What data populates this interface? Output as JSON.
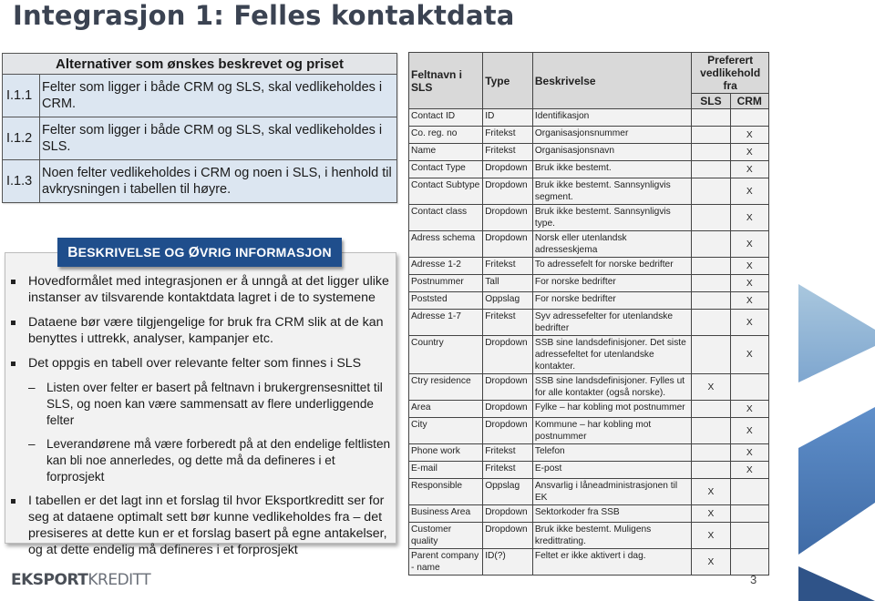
{
  "page": {
    "title": "Integrasjon 1: Felles kontaktdata",
    "page_number": "3",
    "logo": {
      "bold": "EKSPORT",
      "thin": "KREDITT"
    }
  },
  "alternatives": {
    "header": "Alternativer som ønskes beskrevet og priset",
    "rows": [
      {
        "code": "I.1.1",
        "text": "Felter som ligger i både CRM og SLS, skal vedlikeholdes i CRM."
      },
      {
        "code": "I.1.2",
        "text": "Felter som ligger i både CRM og SLS, skal vedlikeholdes i SLS."
      },
      {
        "code": "I.1.3",
        "text": "Noen felter vedlikeholdes i CRM og noen i SLS, i henhold til avkrysningen i tabellen til høyre."
      }
    ]
  },
  "info": {
    "header_caps_1": "B",
    "header_rest_1": "ESKRIVELSE OG ",
    "header_caps_2": "Ø",
    "header_rest_2": "VRIG INFORMASJON",
    "bullets": [
      "Hovedformålet med integrasjonen er å unngå at det ligger ulike instanser av tilsvarende kontaktdata lagret i de to systemene",
      "Dataene bør være tilgjengelige for bruk fra CRM slik at de kan benyttes i uttrekk, analyser, kampanjer etc.",
      "Det oppgis en tabell over relevante felter som finnes i SLS"
    ],
    "subbullets": [
      "Listen over felter er basert på feltnavn i brukergrensesnittet til SLS, og noen kan være sammensatt av flere underliggende felter",
      "Leverandørene må være forberedt på at den endelige feltlisten kan bli noe annerledes, og dette må da defineres i et forprosjekt"
    ],
    "final_bullet": "I tabellen er det lagt inn et forslag til hvor Eksportkreditt ser for seg at dataene optimalt sett bør kunne vedlikeholdes fra – det presiseres at dette kun er et forslag basert på egne antakelser, og at dette endelig må defineres i et forprosjekt"
  },
  "fields_table": {
    "headers": {
      "name": "Feltnavn i SLS",
      "type": "Type",
      "description": "Beskrivelse",
      "preferred": "Preferert vedlikehold fra",
      "sls": "SLS",
      "crm": "CRM"
    },
    "rows": [
      {
        "name": "Contact ID",
        "type": "ID",
        "desc": "Identifikasjon",
        "sls": "",
        "crm": ""
      },
      {
        "name": "Co. reg. no",
        "type": "Fritekst",
        "desc": "Organisasjonsnummer",
        "sls": "",
        "crm": "X"
      },
      {
        "name": "Name",
        "type": "Fritekst",
        "desc": "Organisasjonsnavn",
        "sls": "",
        "crm": "X"
      },
      {
        "name": "Contact Type",
        "type": "Dropdown",
        "desc": "Bruk ikke bestemt.",
        "sls": "",
        "crm": "X"
      },
      {
        "name": "Contact Subtype",
        "type": "Dropdown",
        "desc": "Bruk ikke bestemt. Sannsynligvis segment.",
        "sls": "",
        "crm": "X"
      },
      {
        "name": "Contact class",
        "type": "Dropdown",
        "desc": "Bruk ikke bestemt. Sannsynligvis type.",
        "sls": "",
        "crm": "X"
      },
      {
        "name": "Adress schema",
        "type": "Dropdown",
        "desc": "Norsk eller utenlandsk adresseskjema",
        "sls": "",
        "crm": "X"
      },
      {
        "name": "Adresse 1-2",
        "type": "Fritekst",
        "desc": "To adressefelt for norske bedrifter",
        "sls": "",
        "crm": "X"
      },
      {
        "name": "Postnummer",
        "type": "Tall",
        "desc": "For norske bedrifter",
        "sls": "",
        "crm": "X"
      },
      {
        "name": "Poststed",
        "type": "Oppslag",
        "desc": "For norske bedrifter",
        "sls": "",
        "crm": "X"
      },
      {
        "name": "Adresse 1-7",
        "type": "Fritekst",
        "desc": "Syv adressefelter for utenlandske bedrifter",
        "sls": "",
        "crm": "X"
      },
      {
        "name": "Country",
        "type": "Dropdown",
        "desc": "SSB sine landsdefinisjoner. Det siste adressefeltet for utenlandske kontakter.",
        "sls": "",
        "crm": "X"
      },
      {
        "name": "Ctry residence",
        "type": "Dropdown",
        "desc": "SSB sine landsdefinisjoner. Fylles ut for alle kontakter (også norske).",
        "sls": "X",
        "crm": ""
      },
      {
        "name": "Area",
        "type": "Dropdown",
        "desc": "Fylke – har kobling mot postnummer",
        "sls": "",
        "crm": "X"
      },
      {
        "name": "City",
        "type": "Dropdown",
        "desc": "Kommune – har kobling mot postnummer",
        "sls": "",
        "crm": "X"
      },
      {
        "name": "Phone work",
        "type": "Fritekst",
        "desc": "Telefon",
        "sls": "",
        "crm": "X"
      },
      {
        "name": "E-mail",
        "type": "Fritekst",
        "desc": "E-post",
        "sls": "",
        "crm": "X"
      },
      {
        "name": "Responsible",
        "type": "Oppslag",
        "desc": "Ansvarlig i låneadministrasjonen til EK",
        "sls": "X",
        "crm": ""
      },
      {
        "name": "Business Area",
        "type": "Dropdown",
        "desc": "Sektorkoder fra SSB",
        "sls": "X",
        "crm": ""
      },
      {
        "name": "Customer quality",
        "type": "Dropdown",
        "desc": "Bruk ikke bestemt. Muligens kredittrating.",
        "sls": "X",
        "crm": ""
      },
      {
        "name": "Parent company - name",
        "type": "ID(?)",
        "desc": "Feltet er ikke aktivert i dag.",
        "sls": "X",
        "crm": ""
      }
    ]
  },
  "colors": {
    "brand_blue": "#1f4e8c",
    "alt_row_bg": "#dce6f1",
    "title": "#3b4352"
  }
}
